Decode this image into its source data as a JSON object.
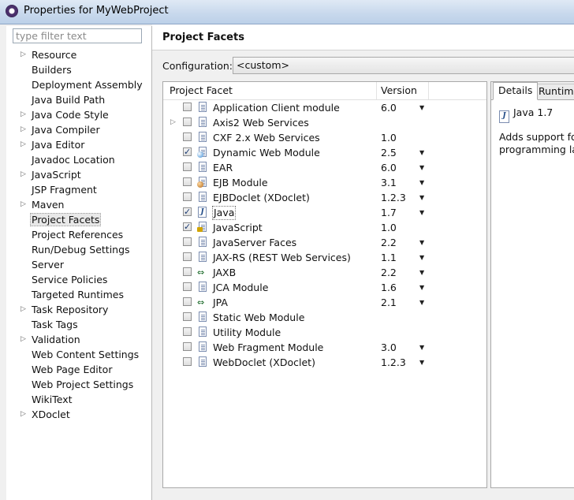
{
  "window": {
    "title": "Properties for MyWebProject"
  },
  "sidebar": {
    "filter_placeholder": "type filter text",
    "items": [
      {
        "label": "Resource",
        "expandable": true
      },
      {
        "label": "Builders",
        "expandable": false
      },
      {
        "label": "Deployment Assembly",
        "expandable": false
      },
      {
        "label": "Java Build Path",
        "expandable": false
      },
      {
        "label": "Java Code Style",
        "expandable": true
      },
      {
        "label": "Java Compiler",
        "expandable": true
      },
      {
        "label": "Java Editor",
        "expandable": true
      },
      {
        "label": "Javadoc Location",
        "expandable": false
      },
      {
        "label": "JavaScript",
        "expandable": true
      },
      {
        "label": "JSP Fragment",
        "expandable": false
      },
      {
        "label": "Maven",
        "expandable": true
      },
      {
        "label": "Project Facets",
        "expandable": false,
        "selected": true
      },
      {
        "label": "Project References",
        "expandable": false
      },
      {
        "label": "Run/Debug Settings",
        "expandable": false
      },
      {
        "label": "Server",
        "expandable": false
      },
      {
        "label": "Service Policies",
        "expandable": false
      },
      {
        "label": "Targeted Runtimes",
        "expandable": false
      },
      {
        "label": "Task Repository",
        "expandable": true
      },
      {
        "label": "Task Tags",
        "expandable": false
      },
      {
        "label": "Validation",
        "expandable": true
      },
      {
        "label": "Web Content Settings",
        "expandable": false
      },
      {
        "label": "Web Page Editor",
        "expandable": false
      },
      {
        "label": "Web Project Settings",
        "expandable": false
      },
      {
        "label": "WikiText",
        "expandable": false
      },
      {
        "label": "XDoclet",
        "expandable": true
      }
    ]
  },
  "main": {
    "title": "Project Facets",
    "configuration_label": "Configuration:",
    "configuration_value": "<custom>",
    "table": {
      "col_facet": "Project Facet",
      "col_version": "Version",
      "rows": [
        {
          "name": "Application Client module",
          "version": "6.0",
          "checked": false,
          "icon": "page-icon",
          "dropdown": true,
          "expandable": false
        },
        {
          "name": "Axis2 Web Services",
          "version": "",
          "checked": false,
          "icon": "page-icon",
          "dropdown": false,
          "expandable": true
        },
        {
          "name": "CXF 2.x Web Services",
          "version": "1.0",
          "checked": false,
          "icon": "page-icon",
          "dropdown": false,
          "expandable": false
        },
        {
          "name": "Dynamic Web Module",
          "version": "2.5",
          "checked": true,
          "icon": "globe-icon",
          "dropdown": true,
          "expandable": false
        },
        {
          "name": "EAR",
          "version": "6.0",
          "checked": false,
          "icon": "page-icon",
          "dropdown": true,
          "expandable": false
        },
        {
          "name": "EJB Module",
          "version": "3.1",
          "checked": false,
          "icon": "bean-icon",
          "dropdown": true,
          "expandable": false
        },
        {
          "name": "EJBDoclet (XDoclet)",
          "version": "1.2.3",
          "checked": false,
          "icon": "page-icon",
          "dropdown": true,
          "expandable": false
        },
        {
          "name": "Java",
          "version": "1.7",
          "checked": true,
          "icon": "java-icon",
          "dropdown": true,
          "expandable": false,
          "selected": true
        },
        {
          "name": "JavaScript",
          "version": "1.0",
          "checked": true,
          "icon": "lock-icon",
          "dropdown": false,
          "expandable": false
        },
        {
          "name": "JavaServer Faces",
          "version": "2.2",
          "checked": false,
          "icon": "page-icon",
          "dropdown": true,
          "expandable": false
        },
        {
          "name": "JAX-RS (REST Web Services)",
          "version": "1.1",
          "checked": false,
          "icon": "page-icon",
          "dropdown": true,
          "expandable": false
        },
        {
          "name": "JAXB",
          "version": "2.2",
          "checked": false,
          "icon": "arrows-icon",
          "dropdown": true,
          "expandable": false
        },
        {
          "name": "JCA Module",
          "version": "1.6",
          "checked": false,
          "icon": "page-icon",
          "dropdown": true,
          "expandable": false
        },
        {
          "name": "JPA",
          "version": "2.1",
          "checked": false,
          "icon": "arrows-icon",
          "dropdown": true,
          "expandable": false
        },
        {
          "name": "Static Web Module",
          "version": "",
          "checked": false,
          "icon": "page-icon",
          "dropdown": false,
          "expandable": false
        },
        {
          "name": "Utility Module",
          "version": "",
          "checked": false,
          "icon": "page-icon",
          "dropdown": false,
          "expandable": false
        },
        {
          "name": "Web Fragment Module",
          "version": "3.0",
          "checked": false,
          "icon": "page-icon",
          "dropdown": true,
          "expandable": false
        },
        {
          "name": "WebDoclet (XDoclet)",
          "version": "1.2.3",
          "checked": false,
          "icon": "page-icon",
          "dropdown": true,
          "expandable": false
        }
      ]
    },
    "details": {
      "tab_details": "Details",
      "tab_runtimes": "Runtimes",
      "heading": "Java 1.7",
      "description_line1": "Adds support for",
      "description_line2": "programming lan"
    }
  }
}
